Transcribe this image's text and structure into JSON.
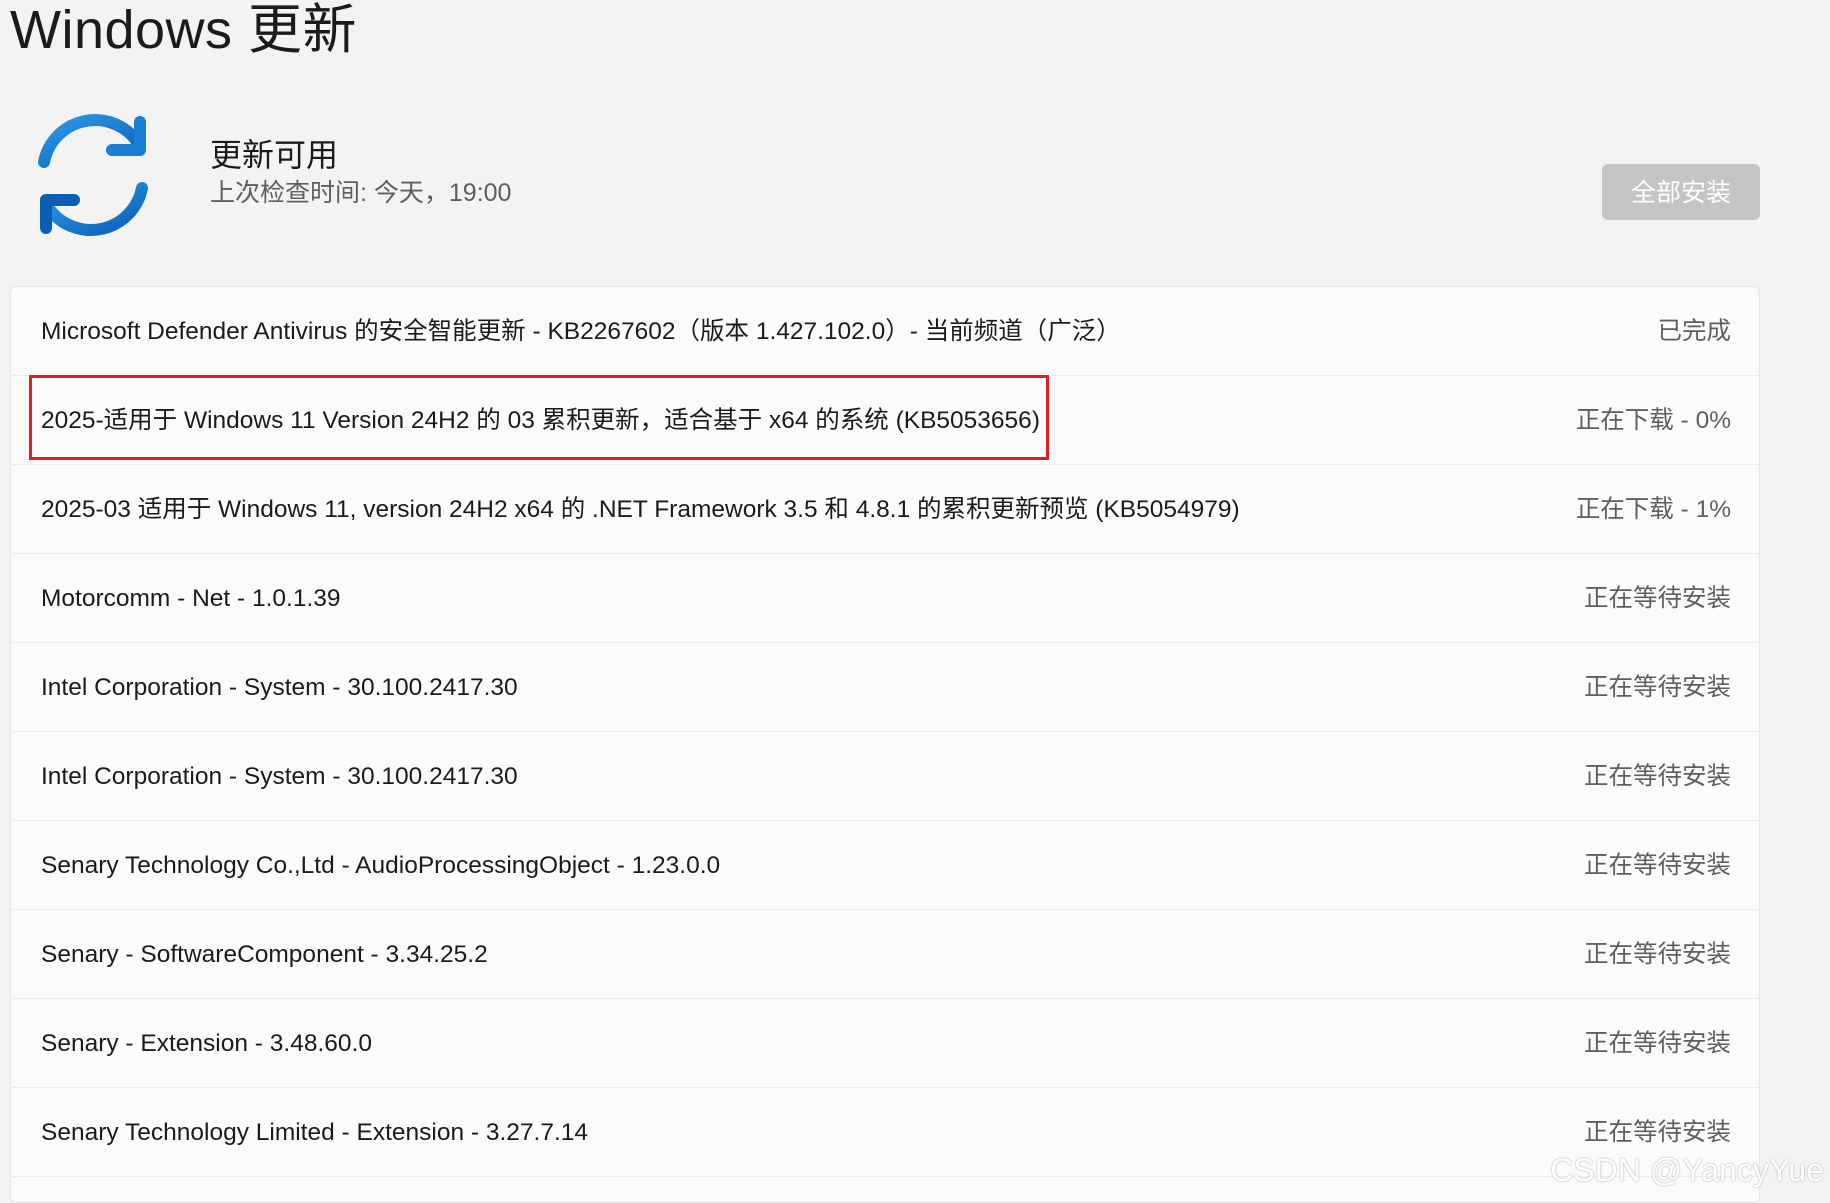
{
  "page": {
    "title": "Windows 更新"
  },
  "status": {
    "icon": "sync-icon",
    "title": "更新可用",
    "last_checked": "上次检查时间: 今天，19:00"
  },
  "actions": {
    "install_all_label": "全部安装"
  },
  "updates": [
    {
      "name": "Microsoft Defender Antivirus 的安全智能更新 - KB2267602（版本 1.427.102.0）- 当前频道（广泛）",
      "status": "已完成"
    },
    {
      "name": "2025-适用于 Windows 11 Version 24H2 的 03 累积更新，适合基于 x64 的系统 (KB5053656)",
      "status": "正在下载 - 0%"
    },
    {
      "name": "2025-03 适用于 Windows 11, version 24H2 x64 的 .NET Framework 3.5 和 4.8.1 的累积更新预览 (KB5054979)",
      "status": "正在下载 - 1%"
    },
    {
      "name": "Motorcomm - Net - 1.0.1.39",
      "status": "正在等待安装"
    },
    {
      "name": "Intel Corporation - System - 30.100.2417.30",
      "status": "正在等待安装"
    },
    {
      "name": "Intel Corporation - System - 30.100.2417.30",
      "status": "正在等待安装"
    },
    {
      "name": "Senary Technology Co.,Ltd - AudioProcessingObject - 1.23.0.0",
      "status": "正在等待安装"
    },
    {
      "name": "Senary - SoftwareComponent - 3.34.25.2",
      "status": "正在等待安装"
    },
    {
      "name": "Senary - Extension - 3.48.60.0",
      "status": "正在等待安装"
    },
    {
      "name": "Senary Technology Limited - Extension - 3.27.7.14",
      "status": "正在等待安装"
    }
  ],
  "colors": {
    "background": "#f3f3f3",
    "card": "#fbfbfb",
    "accent_blue": "#0067c0",
    "highlight_red": "#e31e24",
    "button_disabled": "#c4c4c4"
  },
  "watermark": "CSDN @YancyYue"
}
